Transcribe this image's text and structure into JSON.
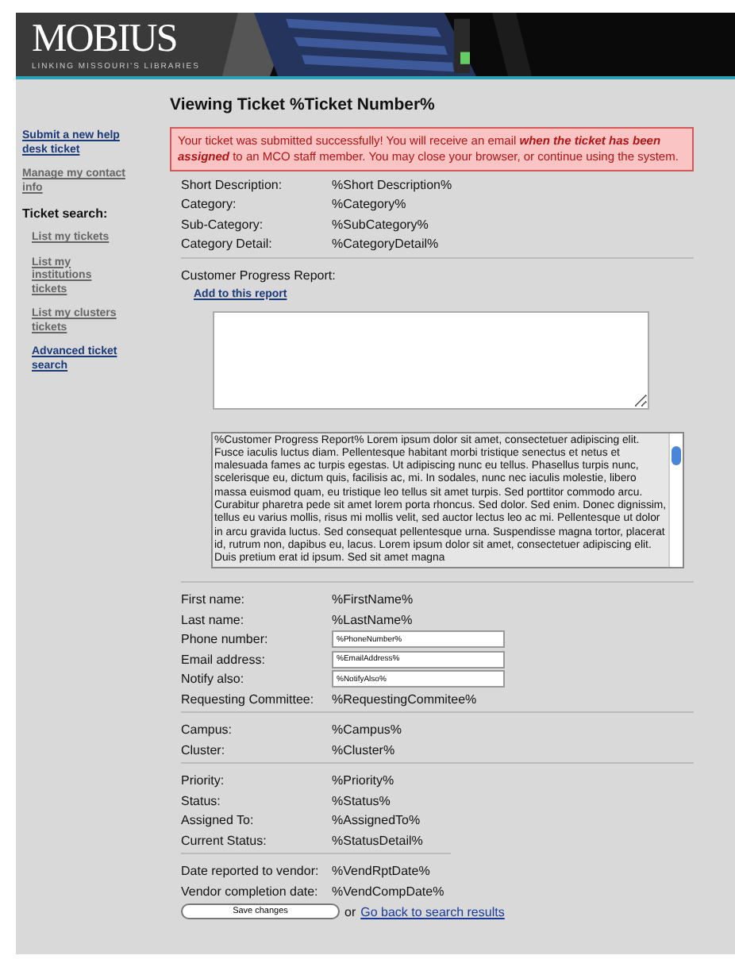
{
  "header": {
    "logo": "MOBIUS",
    "tagline": "LINKING MISSOURI'S LIBRARIES"
  },
  "sidebar": {
    "items": [
      {
        "kind": "link",
        "label": "Submit a new help desk ticket",
        "visited": false
      },
      {
        "kind": "link",
        "label": "Manage my contact info",
        "visited": true
      },
      {
        "kind": "heading",
        "label": "Ticket search:"
      },
      {
        "kind": "sublink",
        "label": "List my tickets",
        "visited": true
      },
      {
        "kind": "sublink",
        "label": "List my institutions tickets",
        "visited": true
      },
      {
        "kind": "sublink",
        "label": "List my clusters tickets",
        "visited": true
      },
      {
        "kind": "sublink",
        "label": "Advanced ticket search",
        "visited": false
      }
    ]
  },
  "title": "Viewing Ticket %Ticket Number%",
  "alert": "Your ticket was submitted successfully! You will receive an email **when the ticket has been assigned** to an MCO staff member. You may close your browser, or continue using the system.",
  "summary": [
    {
      "label": "Short Description:",
      "value": "%Short Description%"
    },
    {
      "label": "Category:",
      "value": "%Category%"
    },
    {
      "label": "Sub-Category:",
      "value": "%SubCategory%"
    },
    {
      "label": "Category Detail:",
      "value": "%CategoryDetail%"
    }
  ],
  "progress": {
    "label": "Customer Progress Report:",
    "add_link": "Add to this report",
    "report": "%Customer Progress Report% Lorem ipsum dolor sit amet, consectetuer adipiscing elit. Fusce iaculis luctus diam. Pellentesque habitant morbi tristique senectus et netus et malesuada fames ac turpis egestas. Ut adipiscing nunc eu tellus. Phasellus turpis nunc, scelerisque eu, dictum quis, facilisis ac, mi. In sodales, nunc nec iaculis molestie, libero massa euismod quam, eu tristique leo tellus sit amet turpis. Sed porttitor commodo arcu. Curabitur pharetra pede sit amet lorem porta rhoncus. Sed dolor. Sed enim. Donec dignissim, tellus eu varius mollis, risus mi mollis velit, sed auctor lectus leo ac mi. Pellentesque ut dolor in arcu gravida luctus. Sed consequat pellentesque urna. Suspendisse magna tortor, placerat id, rutrum non, dapibus eu, lacus. Lorem ipsum dolor sit amet, consectetuer adipiscing elit. Duis pretium erat id ipsum. Sed sit amet magna"
  },
  "groups": [
    {
      "rows": [
        {
          "kind": "text",
          "label": "First name:",
          "value": "%FirstName%"
        },
        {
          "kind": "text",
          "label": "Last name:",
          "value": "%LastName%"
        },
        {
          "kind": "input",
          "label": "Phone number:",
          "value": "%PhoneNumber%"
        },
        {
          "kind": "input",
          "label": "Email address:",
          "value": "%EmailAddress%"
        },
        {
          "kind": "input",
          "label": "Notify also:",
          "value": "%NotifyAlso%"
        },
        {
          "kind": "text",
          "label": "Requesting Committee:",
          "value": "%RequestingCommitee%"
        }
      ]
    },
    {
      "rows": [
        {
          "kind": "text",
          "label": "Campus:",
          "value": "%Campus%"
        },
        {
          "kind": "text",
          "label": "Cluster:",
          "value": "%Cluster%"
        }
      ]
    },
    {
      "rows": [
        {
          "kind": "text",
          "label": "Priority:",
          "value": "%Priority%"
        },
        {
          "kind": "text",
          "label": "Status:",
          "value": "%Status%"
        },
        {
          "kind": "text",
          "label": "Assigned To:",
          "value": "%AssignedTo%"
        },
        {
          "kind": "text",
          "label": "Current Status:",
          "value": "%StatusDetail%"
        }
      ]
    },
    {
      "rows": [
        {
          "kind": "text",
          "label": "Date reported to vendor:",
          "value": "%VendRptDate%"
        },
        {
          "kind": "text",
          "label": "Vendor completion date:",
          "value": "%VendCompDate%"
        }
      ]
    }
  ],
  "actions": {
    "save": "Save changes",
    "or": "or",
    "back": "Go back to search results"
  }
}
